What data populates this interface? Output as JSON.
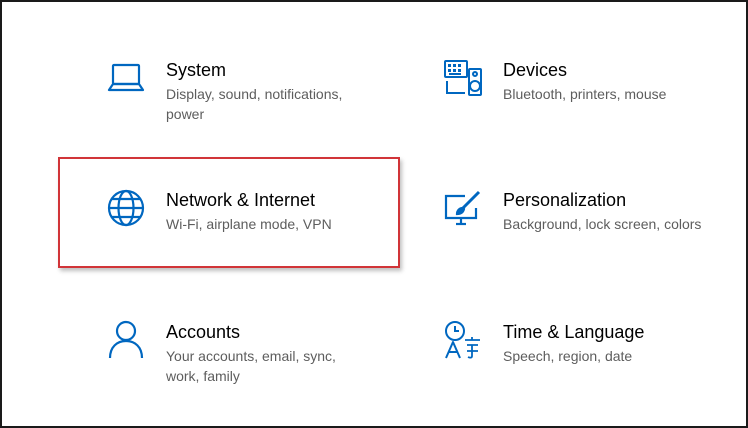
{
  "accent_color": "#0067c0",
  "highlight_color": "#d13438",
  "tiles": {
    "system": {
      "icon": "laptop-icon",
      "title": "System",
      "description": "Display, sound, notifications, power"
    },
    "devices": {
      "icon": "keyboard-speaker-icon",
      "title": "Devices",
      "description": "Bluetooth, printers, mouse"
    },
    "network": {
      "icon": "globe-icon",
      "title": "Network & Internet",
      "description": "Wi-Fi, airplane mode, VPN"
    },
    "personalization": {
      "icon": "paint-brush-screen-icon",
      "title": "Personalization",
      "description": "Background, lock screen, colors"
    },
    "accounts": {
      "icon": "person-icon",
      "title": "Accounts",
      "description": "Your accounts, email, sync, work, family"
    },
    "time_language": {
      "icon": "time-language-icon",
      "title": "Time & Language",
      "description": "Speech, region, date"
    }
  }
}
